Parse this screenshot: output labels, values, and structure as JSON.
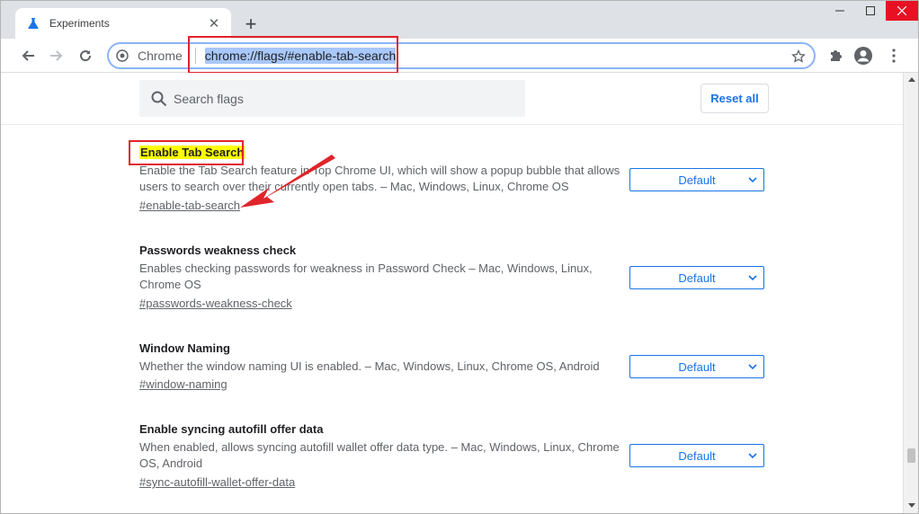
{
  "tab": {
    "title": "Experiments",
    "close_glyph": "✕"
  },
  "new_tab_glyph": "+",
  "omnibox": {
    "site_label": "Chrome",
    "url": "chrome://flags/#enable-tab-search"
  },
  "search": {
    "placeholder": "Search flags"
  },
  "reset_all_label": "Reset all",
  "flags": [
    {
      "name": "Enable Tab Search",
      "description": "Enable the Tab Search feature in Top Chrome UI, which will show a popup bubble that allows users to search over their currently open tabs. – Mac, Windows, Linux, Chrome OS",
      "link": "#enable-tab-search",
      "value": "Default"
    },
    {
      "name": "Passwords weakness check",
      "description": "Enables checking passwords for weakness in Password Check – Mac, Windows, Linux, Chrome OS",
      "link": "#passwords-weakness-check",
      "value": "Default"
    },
    {
      "name": "Window Naming",
      "description": "Whether the window naming UI is enabled. – Mac, Windows, Linux, Chrome OS, Android",
      "link": "#window-naming",
      "value": "Default"
    },
    {
      "name": "Enable syncing autofill offer data",
      "description": "When enabled, allows syncing autofill wallet offer data type. – Mac, Windows, Linux, Chrome OS, Android",
      "link": "#sync-autofill-wallet-offer-data",
      "value": "Default"
    }
  ],
  "colors": {
    "accent": "#1a73e8",
    "annotation_red": "#e0242a",
    "highlight_yellow": "#ffff00"
  },
  "icons": [
    "flask-icon",
    "close-icon",
    "plus-icon",
    "minimize-icon",
    "maximize-icon",
    "window-close-icon",
    "back-arrow-icon",
    "forward-arrow-icon",
    "reload-icon",
    "chrome-logo-icon",
    "star-icon",
    "puzzle-icon",
    "profile-icon",
    "kebab-menu-icon",
    "search-icon",
    "chevron-down-icon"
  ]
}
